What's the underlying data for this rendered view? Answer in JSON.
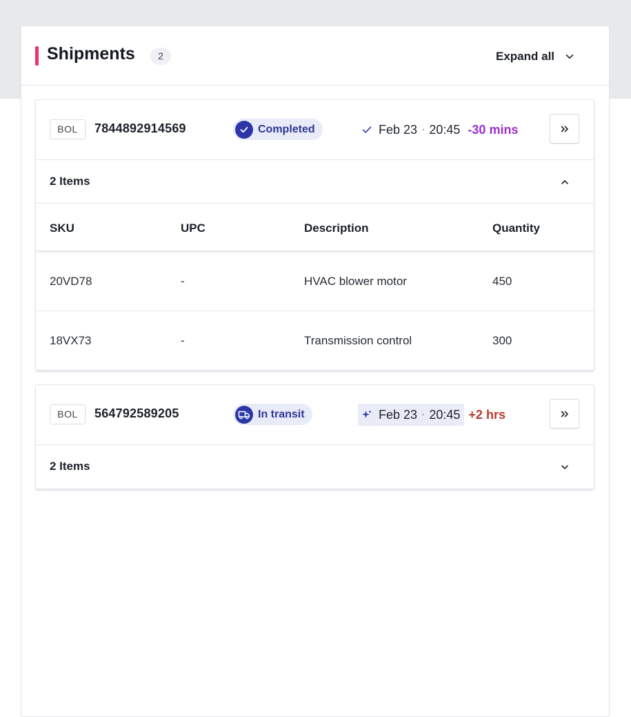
{
  "colors": {
    "accent": "#e8336c",
    "status_blue": "#2b37a6",
    "early_purple": "#9b2fd0",
    "late_red": "#b43a2e"
  },
  "panel": {
    "title": "Shipments",
    "count": "2",
    "expand_all_label": "Expand all"
  },
  "shipments": [
    {
      "bol_tag": "BOL",
      "bol_number": "7844892914569",
      "status": {
        "label": "Completed",
        "icon": "check-icon"
      },
      "eta": {
        "icon": "check-icon",
        "date": "Feb 23",
        "separator": "·",
        "time": "20:45",
        "delta": "-30 mins"
      },
      "items_label": "2 Items",
      "expanded": true,
      "columns": [
        "SKU",
        "UPC",
        "Description",
        "Quantity"
      ],
      "rows": [
        {
          "sku": "20VD78",
          "upc": "-",
          "description": "HVAC blower motor",
          "quantity": "450"
        },
        {
          "sku": "18VX73",
          "upc": "-",
          "description": "Transmission control",
          "quantity": "300"
        }
      ]
    },
    {
      "bol_tag": "BOL",
      "bol_number": "564792589205",
      "status": {
        "label": "In transit",
        "icon": "truck-icon"
      },
      "eta": {
        "icon": "sparkle-icon",
        "date": "Feb 23",
        "separator": "·",
        "time": "20:45",
        "delta": "+2 hrs"
      },
      "items_label": "2 Items",
      "expanded": false
    }
  ]
}
